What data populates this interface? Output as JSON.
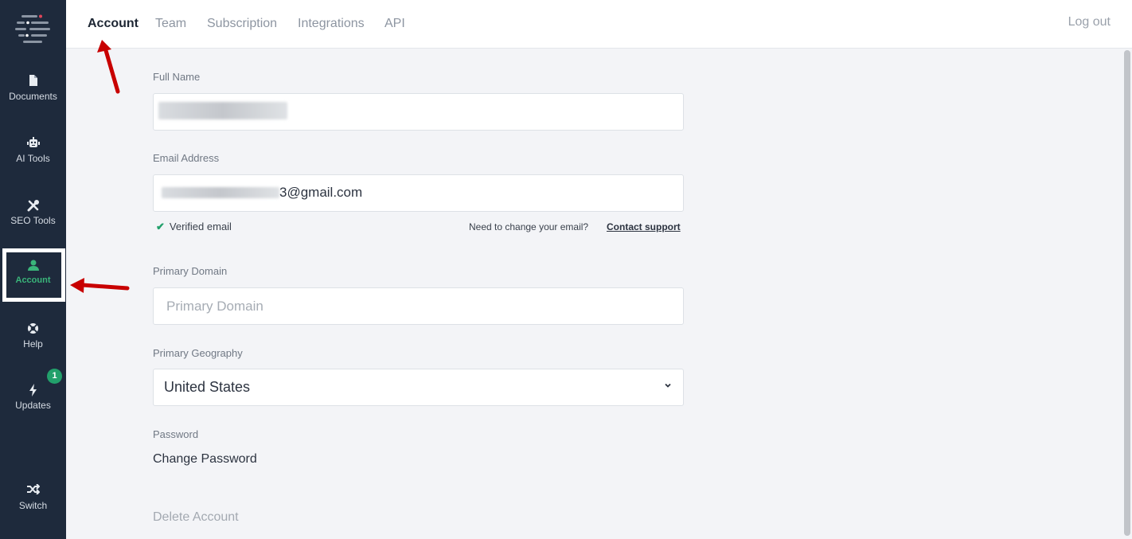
{
  "tabs": [
    "Account",
    "Team",
    "Subscription",
    "Integrations",
    "API"
  ],
  "logout_label": "Log out",
  "sidebar": {
    "items": [
      {
        "label": "Documents",
        "icon": "document-icon"
      },
      {
        "label": "AI Tools",
        "icon": "robot-icon"
      },
      {
        "label": "SEO Tools",
        "icon": "tools-icon"
      },
      {
        "label": "Account",
        "icon": "user-icon"
      },
      {
        "label": "Help",
        "icon": "lifebuoy-icon"
      },
      {
        "label": "Updates",
        "icon": "lightning-icon"
      },
      {
        "label": "Switch",
        "icon": "shuffle-icon"
      }
    ],
    "updates_badge": "1"
  },
  "form": {
    "full_name_label": "Full Name",
    "email_label": "Email Address",
    "email_value": "3@gmail.com",
    "verified_label": "Verified email",
    "change_email_question": "Need to change your email?",
    "contact_support_label": "Contact support",
    "primary_domain_label": "Primary Domain",
    "primary_domain_placeholder": "Primary Domain",
    "primary_geography_label": "Primary Geography",
    "primary_geography_value": "United States",
    "password_label": "Password",
    "change_password_label": "Change Password",
    "delete_account_label": "Delete Account"
  },
  "colors": {
    "sidebar_bg": "#1e2a3c",
    "accent_green": "#22a06b",
    "annotation_arrow": "#d40000"
  }
}
